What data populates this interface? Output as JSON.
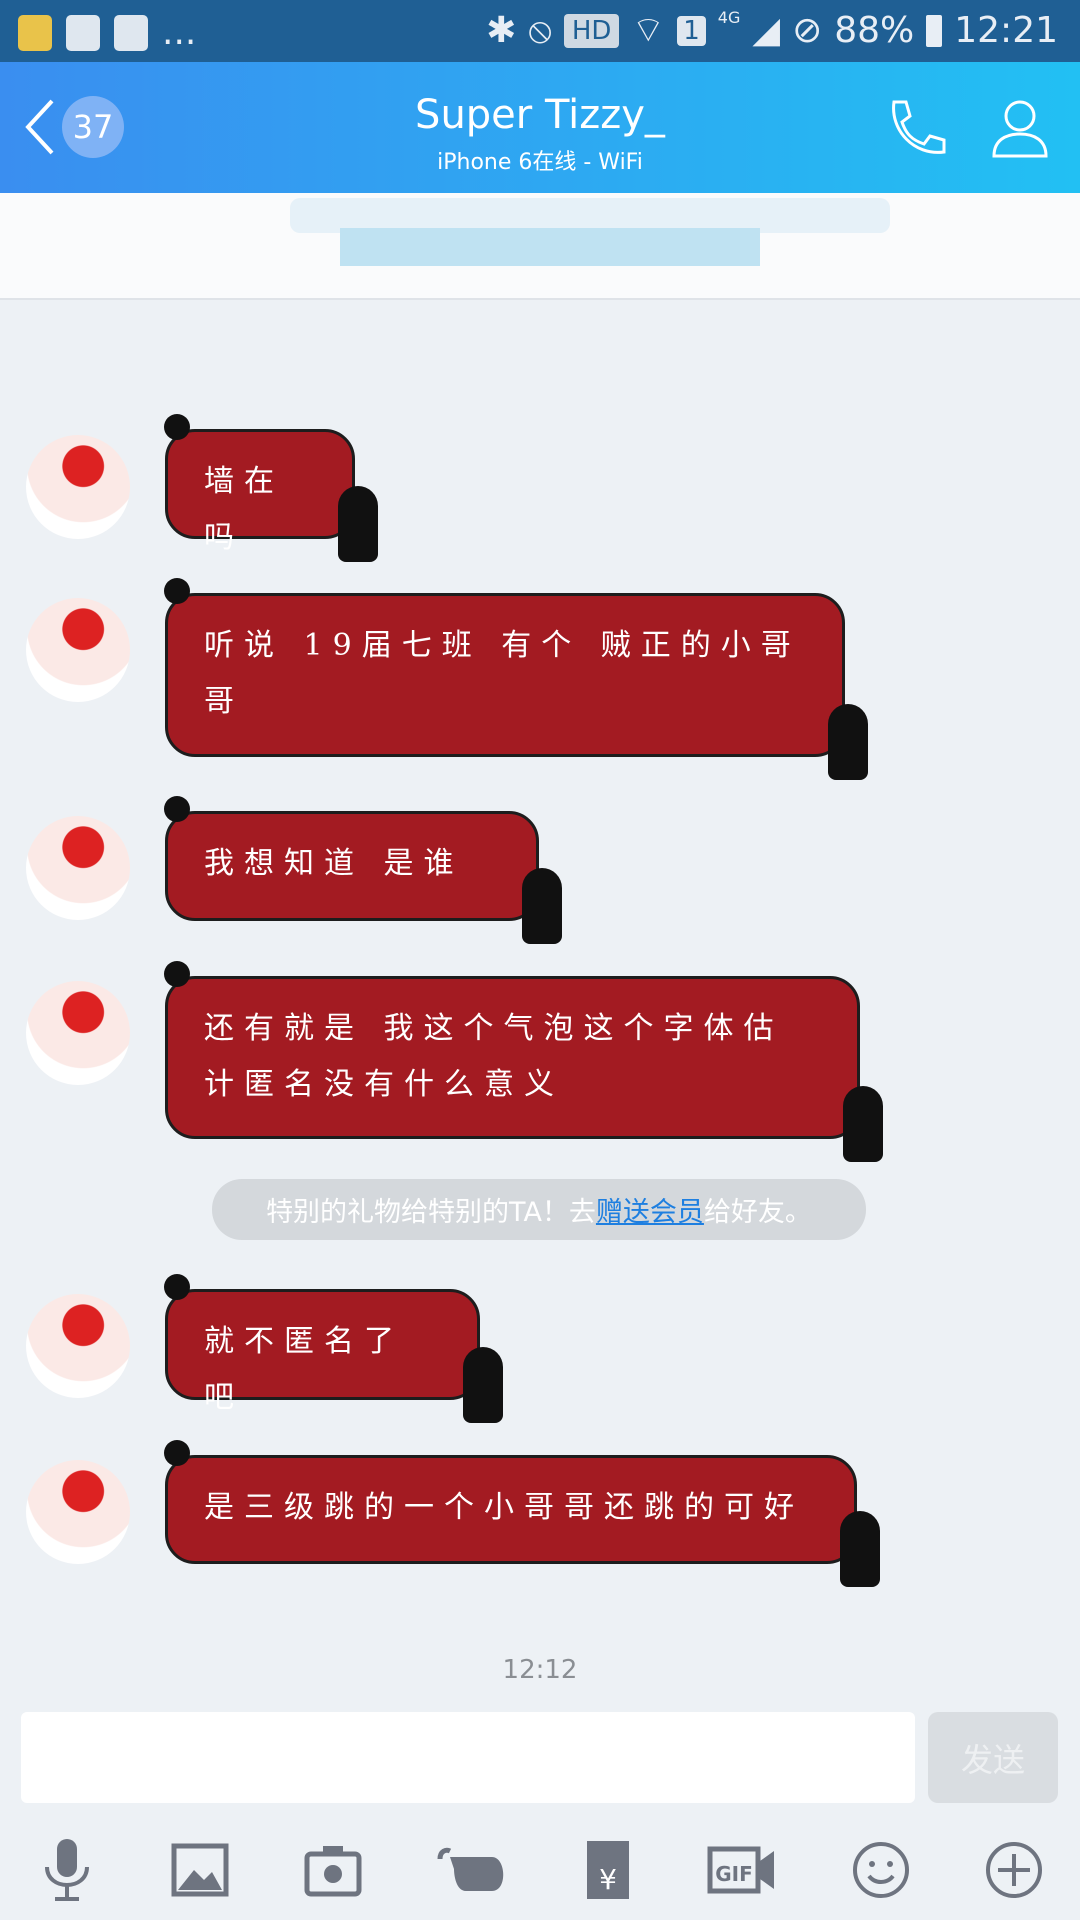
{
  "status_bar": {
    "battery": "88%",
    "time": "12:21",
    "hd": "HD",
    "sim": "1",
    "network": "4G",
    "more": "..."
  },
  "header": {
    "unread_count": "37",
    "title": "Super Tizzy_",
    "subtitle": "iPhone 6在线 - WiFi"
  },
  "messages": [
    {
      "text": "墙在吗"
    },
    {
      "text": "听说 19届七班  有个  贼正的小哥哥"
    },
    {
      "text": "我想知道   是谁"
    },
    {
      "text": "还有就是  我这个气泡这个字体估计匿名没有什么意义"
    },
    {
      "text": "就不匿名了吧"
    },
    {
      "text": "是三级跳的一个小哥哥还跳的可好"
    }
  ],
  "notice": {
    "prefix": "特别的礼物给特别的TA！去",
    "link": "赠送会员",
    "suffix": "给好友。"
  },
  "timestamp": "12:12",
  "input": {
    "value": "",
    "send_label": "发送"
  },
  "toolbar": [
    "microphone-icon",
    "image-icon",
    "camera-icon",
    "poke-icon",
    "red-packet-icon",
    "gif-icon",
    "emoji-icon",
    "plus-icon"
  ],
  "colors": {
    "bubble": "#a31b22",
    "header_start": "#3a8ef0",
    "header_end": "#22c0f3",
    "link": "#1e7fe0"
  }
}
